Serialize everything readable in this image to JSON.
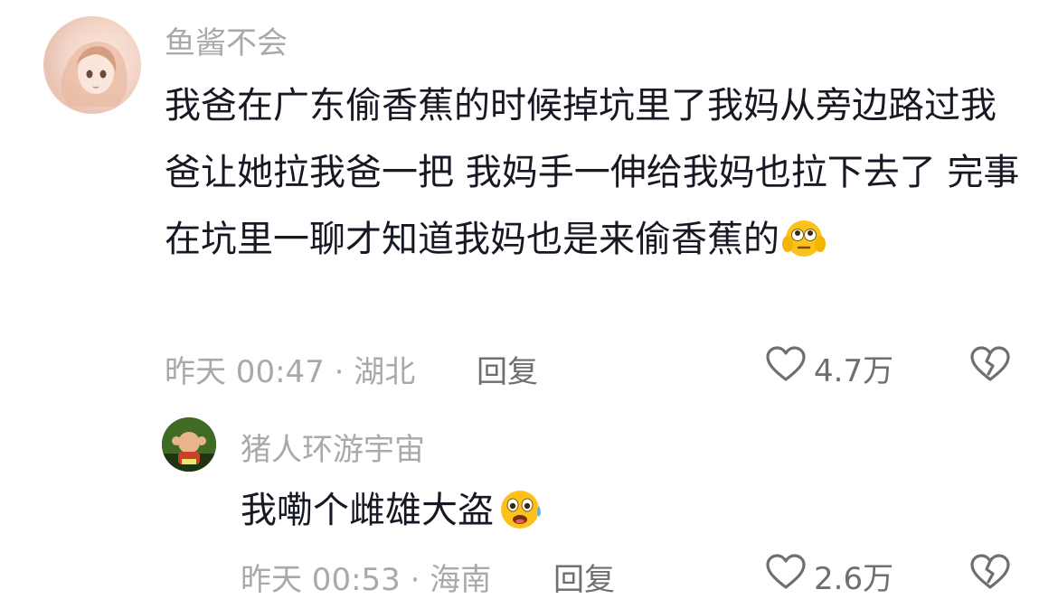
{
  "comments": [
    {
      "username": "鱼酱不会",
      "text": "我爸在广东偷香蕉的时候掉坑里了我妈从旁边路过我爸让她拉我爸一把 我妈手一伸给我妈也拉下去了 完事在坑里一聊才知道我妈也是来偷香蕉的",
      "emoji": "flushed-face-hands-emoji",
      "meta": "昨天 00:47 · 湖北",
      "reply_label": "回复",
      "like_count": "4.7万"
    },
    {
      "username": "猪人环游宇宙",
      "text": "我嘞个雌雄大盗",
      "emoji": "shocked-sweat-face-emoji",
      "meta": "昨天 00:53 · 海南",
      "reply_label": "回复",
      "like_count": "2.6万"
    }
  ],
  "icons": {
    "like": "heart-outline-icon",
    "dislike": "broken-heart-outline-icon"
  },
  "colors": {
    "text": "#161823",
    "secondary": "#a9a9ad",
    "action": "#6e6e73",
    "emoji_yellow": "#fcc21b"
  }
}
